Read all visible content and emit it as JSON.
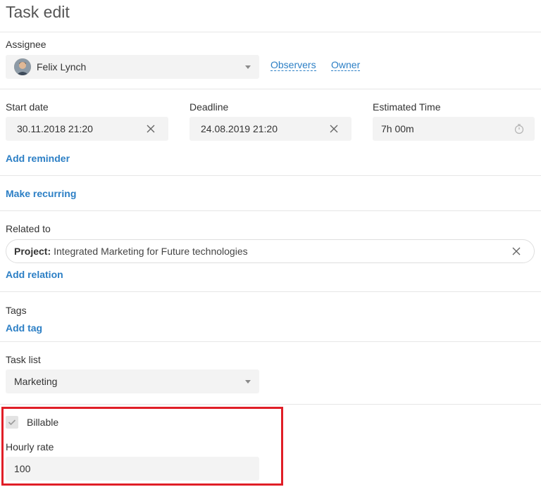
{
  "page": {
    "title": "Task edit"
  },
  "assignee": {
    "label": "Assignee",
    "value": "Felix Lynch",
    "observers_link": "Observers",
    "owner_link": "Owner"
  },
  "dates": {
    "start": {
      "label": "Start date",
      "value": "30.11.2018 21:20"
    },
    "deadline": {
      "label": "Deadline",
      "value": "24.08.2019 21:20"
    },
    "estimated": {
      "label": "Estimated Time",
      "value": "7h 00m"
    },
    "add_reminder": "Add reminder"
  },
  "recurring": {
    "link": "Make recurring"
  },
  "related": {
    "label": "Related to",
    "key": "Project:",
    "value": "Integrated Marketing for Future technologies",
    "add_relation": "Add relation"
  },
  "tags": {
    "label": "Tags",
    "add_tag": "Add tag"
  },
  "task_list": {
    "label": "Task list",
    "value": "Marketing"
  },
  "billing": {
    "billable_label": "Billable",
    "billable_checked": true,
    "hourly_rate_label": "Hourly rate",
    "hourly_rate_value": "100"
  },
  "colors": {
    "link": "#2c7fc5",
    "field_bg": "#f3f3f3",
    "highlight": "#e01e27"
  }
}
